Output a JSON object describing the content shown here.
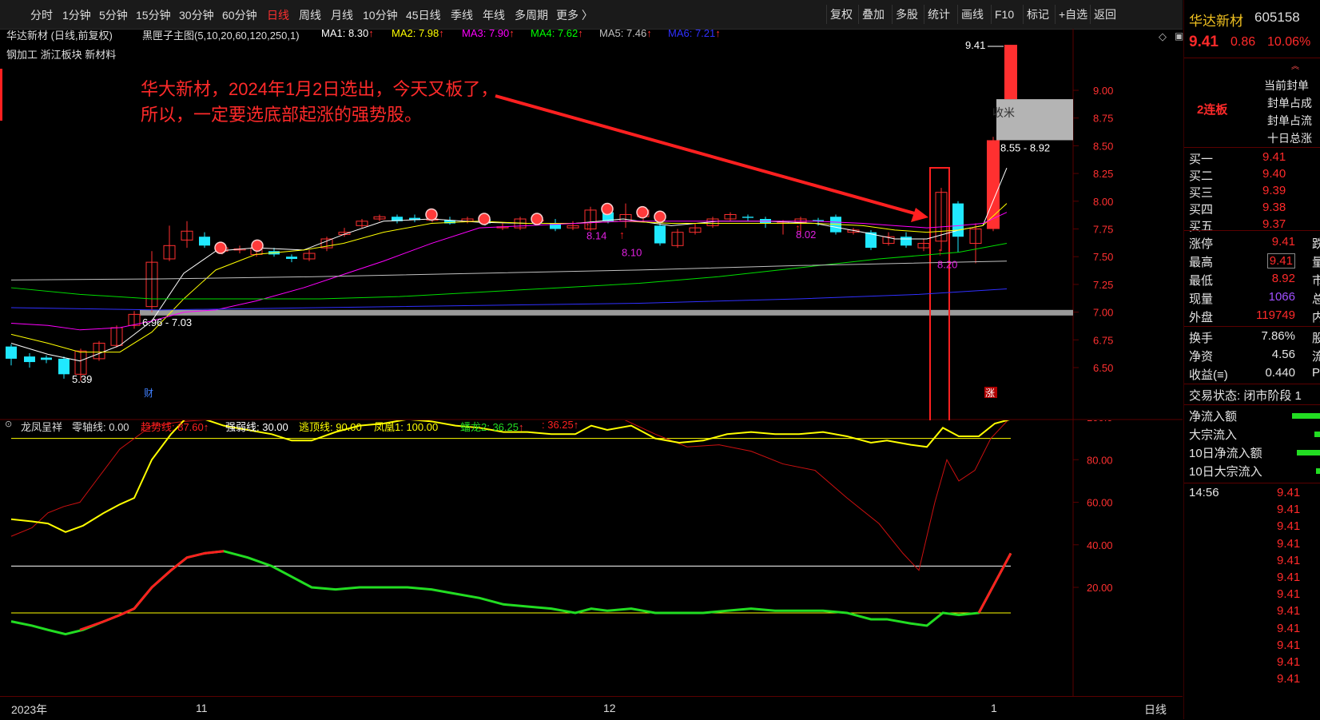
{
  "toolbar": {
    "periods": [
      "分时",
      "1分钟",
      "5分钟",
      "15分钟",
      "30分钟",
      "60分钟",
      "日线",
      "周线",
      "月线",
      "10分钟",
      "45日线",
      "季线",
      "年线",
      "多周期",
      "更多 〉"
    ],
    "active": "日线",
    "right_buttons": [
      "复权",
      "叠加",
      "多股",
      "统计",
      "画线",
      "F10",
      "标记",
      "+自选",
      "返回"
    ]
  },
  "main": {
    "title": "华达新材 (日线,前复权)",
    "indicator_name": "黑匣子主图(5,10,20,60,120,250,1)",
    "ma": [
      {
        "label": "MA1: 8.30",
        "color": "#ffffff"
      },
      {
        "label": "MA2: 7.98",
        "color": "#ffff00"
      },
      {
        "label": "MA3: 7.90",
        "color": "#ff00ff"
      },
      {
        "label": "MA4: 7.62",
        "color": "#00ff00"
      },
      {
        "label": "MA5: 7.46",
        "color": "#c0c0c0"
      },
      {
        "label": "MA6: 7.21",
        "color": "#3030ff"
      }
    ],
    "tags": "钢加工  浙江板块  新材料",
    "annotation_line1": "华大新材，2024年1月2日选出，今天又板了，",
    "annotation_line2": "所以，一定要选底部起涨的强势股。",
    "price_ticks": [
      "9.00",
      "8.75",
      "8.50",
      "8.25",
      "8.00",
      "7.75",
      "7.50",
      "7.25",
      "7.00",
      "6.75",
      "6.50"
    ],
    "labels": {
      "high": "9.41",
      "low": "5.39",
      "range1": "6.96 - 7.03",
      "range2": "8.55 - 8.92",
      "shoumi": "收米",
      "cai": "财",
      "zhang": "涨",
      "p814": "8.14",
      "p810": "8.10",
      "p802": "8.02",
      "p820": "8.20"
    }
  },
  "indicator": {
    "name": "龙凤呈祥",
    "lines": [
      {
        "label": "零轴线: 0.00",
        "color": "#dddddd"
      },
      {
        "label": "趋势线: 87.60",
        "color": "#ff2020"
      },
      {
        "label": "强弱线: 30.00",
        "color": "#ffffff"
      },
      {
        "label": "逃顶线: 90.00",
        "color": "#ffff00"
      },
      {
        "label": "凤凰1: 100.00",
        "color": "#ffff00"
      },
      {
        "label": "蟠龙2: 36.25",
        "color": "#22dd22"
      },
      {
        "label": ": 36.25",
        "color": "#ff2020"
      }
    ],
    "ticks": [
      "100.0",
      "80.00",
      "60.00",
      "40.00",
      "20.00"
    ]
  },
  "xaxis": {
    "labels": [
      "2023年",
      "11",
      "12",
      "1"
    ],
    "period": "日线"
  },
  "right": {
    "name": "华达新材",
    "code": "605158",
    "price": "9.41",
    "change": "0.86",
    "pct": "10.06%",
    "lianban": "2连板",
    "seal_labels": [
      "当前封单",
      "封单占成",
      "封单占流",
      "十日总涨"
    ],
    "bids": [
      {
        "label": "买一",
        "price": "9.41"
      },
      {
        "label": "买二",
        "price": "9.40"
      },
      {
        "label": "买三",
        "price": "9.39"
      },
      {
        "label": "买四",
        "price": "9.38"
      },
      {
        "label": "买五",
        "price": "9.37"
      }
    ],
    "stats": [
      {
        "label": "涨停",
        "value": "9.41",
        "color": "#ff2a2a",
        "r": "跌"
      },
      {
        "label": "最高",
        "value": "9.41",
        "color": "#ff2a2a",
        "r": "量"
      },
      {
        "label": "最低",
        "value": "8.92",
        "color": "#ff2a2a",
        "r": "市"
      },
      {
        "label": "现量",
        "value": "1066",
        "color": "#a050ff",
        "r": "总"
      },
      {
        "label": "外盘",
        "value": "119749",
        "color": "#ff2a2a",
        "r": "内"
      }
    ],
    "stats2": [
      {
        "label": "换手",
        "value": "7.86%",
        "r": "股"
      },
      {
        "label": "净资",
        "value": "4.56",
        "r": "流"
      },
      {
        "label": "收益(≡)",
        "value": "0.440",
        "r": "P"
      }
    ],
    "trade_state": "交易状态: 闭市阶段 1",
    "flows": [
      {
        "label": "净流入额",
        "bar": 36
      },
      {
        "label": "大宗流入",
        "bar": 8
      },
      {
        "label": "10日净流入额",
        "bar": 30
      },
      {
        "label": "10日大宗流入",
        "bar": 6
      }
    ],
    "tick_time": "14:56",
    "ticks": [
      "9.41",
      "9.41",
      "9.41",
      "9.41",
      "9.41",
      "9.41",
      "9.41",
      "9.41",
      "9.41",
      "9.41",
      "9.41",
      "9.41"
    ]
  }
}
